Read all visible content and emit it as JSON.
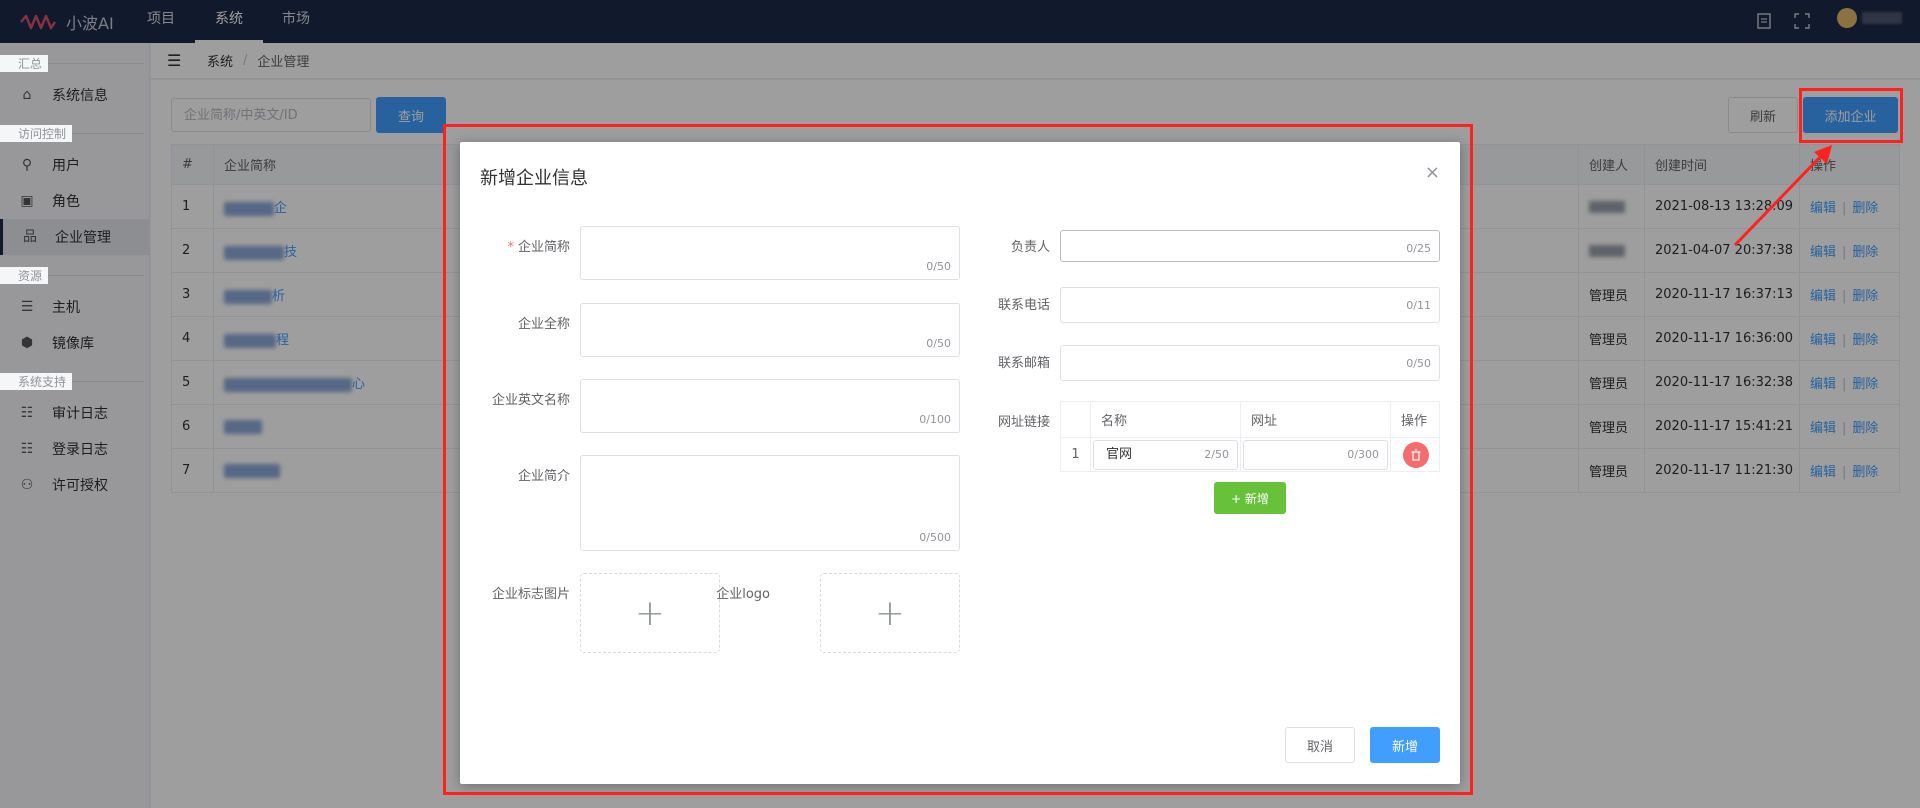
{
  "app": {
    "name": "小波AI"
  },
  "nav": {
    "items": [
      "项目",
      "系统",
      "市场"
    ],
    "active": "系统"
  },
  "topbar_icons": [
    "document-icon",
    "fullscreen-icon"
  ],
  "sidebar": {
    "groups": [
      {
        "title": "汇总",
        "items": [
          "系统信息"
        ]
      },
      {
        "title": "访问控制",
        "items": [
          "用户",
          "角色",
          "企业管理"
        ]
      },
      {
        "title": "资源",
        "items": [
          "主机",
          "镜像库"
        ]
      },
      {
        "title": "系统支持",
        "items": [
          "审计日志",
          "登录日志",
          "许可授权"
        ]
      }
    ],
    "active": "企业管理"
  },
  "breadcrumb": {
    "root": "系统",
    "current": "企业管理"
  },
  "toolbar": {
    "search_placeholder": "企业简称/中英文/ID",
    "query_label": "查询",
    "refresh_label": "刷新",
    "add_label": "添加企业"
  },
  "table": {
    "headers": {
      "index": "#",
      "name": "企业简称",
      "creator": "创建人",
      "created": "创建时间",
      "ops": "操作"
    },
    "rows": [
      {
        "index": "1",
        "name_tail": "企",
        "creator": "",
        "created": "2021-08-13 13:28:09"
      },
      {
        "index": "2",
        "name_tail": "技",
        "creator": "",
        "created": "2021-04-07 20:37:38"
      },
      {
        "index": "3",
        "name_tail": "析",
        "creator": "管理员",
        "created": "2020-11-17 16:37:13"
      },
      {
        "index": "4",
        "name_tail": "程",
        "creator": "管理员",
        "created": "2020-11-17 16:36:00"
      },
      {
        "index": "5",
        "name_tail": "心",
        "creator": "管理员",
        "created": "2020-11-17 16:32:38"
      },
      {
        "index": "6",
        "name_tail": "",
        "creator": "管理员",
        "created": "2020-11-17 15:41:21"
      },
      {
        "index": "7",
        "name_tail": "",
        "creator": "管理员",
        "created": "2020-11-17 11:21:30"
      }
    ],
    "edit_label": "编辑",
    "delete_label": "删除"
  },
  "dialog": {
    "title": "新增企业信息",
    "close_glyph": "×",
    "left_fields": [
      {
        "label": "企业简称",
        "required": true,
        "count": "0/50"
      },
      {
        "label": "企业全称",
        "required": false,
        "count": "0/50"
      },
      {
        "label": "企业英文名称",
        "required": false,
        "count": "0/100"
      },
      {
        "label": "企业简介",
        "required": false,
        "count": "0/500"
      }
    ],
    "required_mark": "*",
    "upload_logo_image_label": "企业标志图片",
    "upload_logo_label": "企业logo",
    "upload_glyph": "+",
    "right_fields": [
      {
        "label": "负责人",
        "count": "0/25"
      },
      {
        "label": "联系电话",
        "count": "0/11"
      },
      {
        "label": "联系邮箱",
        "count": "0/50"
      }
    ],
    "links": {
      "label": "网址链接",
      "headers": {
        "name": "名称",
        "url": "网址",
        "ops": "操作"
      },
      "rows": [
        {
          "index": "1",
          "name": "官网",
          "name_count": "2/50",
          "url": "",
          "url_count": "0/300"
        }
      ],
      "add_label": "+ 新增"
    },
    "cancel_label": "取消",
    "confirm_label": "新增"
  },
  "colors": {
    "topbar": "#1c2a47",
    "primary": "#409eff",
    "success": "#67c23a",
    "danger": "#f56c6c",
    "highlight": "#ff2020"
  }
}
